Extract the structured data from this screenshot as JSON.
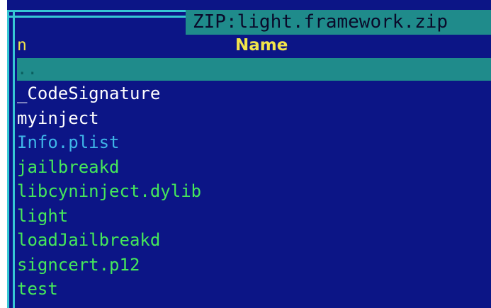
{
  "window": {
    "title": "ZIP:light.framework.zip"
  },
  "header": {
    "col_n": "n",
    "col_name": "Name"
  },
  "selected_entry": "..",
  "files": [
    {
      "label": "_CodeSignature",
      "color": "#ffffff",
      "kind": "directory"
    },
    {
      "label": "myinject",
      "color": "#ffffff",
      "kind": "directory"
    },
    {
      "label": "Info.plist",
      "color": "#3fb6e8",
      "kind": "file"
    },
    {
      "label": "jailbreakd",
      "color": "#45e85a",
      "kind": "executable"
    },
    {
      "label": "libcyninject.dylib",
      "color": "#45e85a",
      "kind": "executable"
    },
    {
      "label": "light",
      "color": "#45e85a",
      "kind": "executable"
    },
    {
      "label": "loadJailbreakd",
      "color": "#45e85a",
      "kind": "executable"
    },
    {
      "label": "signcert.p12",
      "color": "#45e85a",
      "kind": "executable"
    },
    {
      "label": "test",
      "color": "#45e85a",
      "kind": "executable"
    }
  ],
  "colors": {
    "panel_bg": "#0c1586",
    "frame": "#36c7d4",
    "highlight": "#1f8b8b",
    "header_text": "#f1e44a"
  }
}
